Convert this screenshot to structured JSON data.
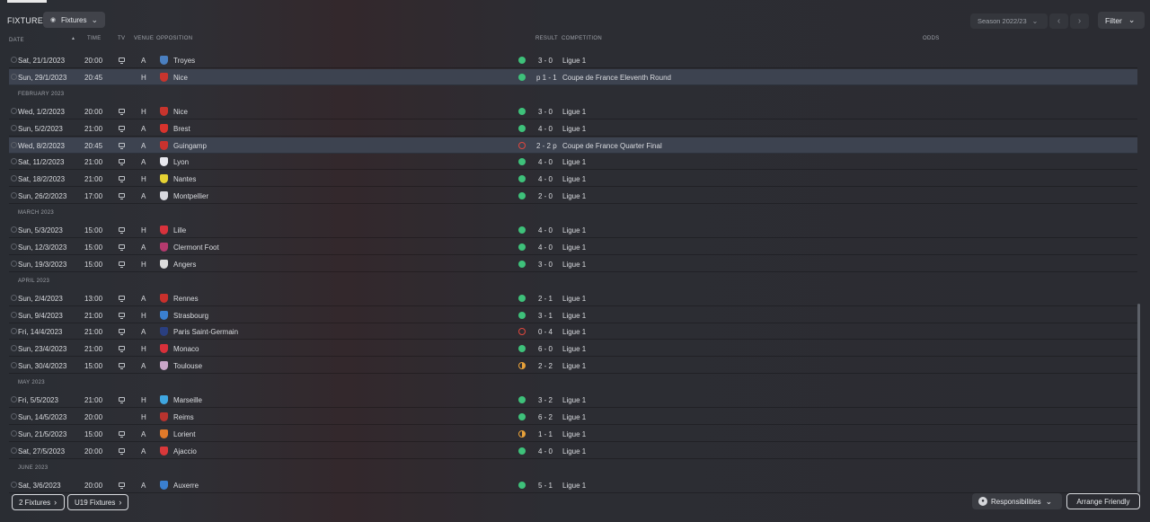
{
  "header": {
    "title": "FIXTURES",
    "view_dropdown": "Fixtures",
    "season": "Season 2022/23",
    "filter": "Filter"
  },
  "columns": {
    "date": "DATE",
    "time": "TIME",
    "tv": "TV",
    "venue": "VENUE",
    "opposition": "OPPOSITION",
    "result": "RESULT",
    "competition": "COMPETITION",
    "odds": "ODDS"
  },
  "rows": [
    {
      "kind": "match",
      "date": "Sat, 21/1/2023",
      "time": "20:00",
      "tv": true,
      "venue": "A",
      "opp": "Troyes",
      "crest": "#4a7fc0",
      "outcome": "win",
      "score": "3 - 0",
      "comp": "Ligue 1"
    },
    {
      "kind": "match",
      "date": "Sun, 29/1/2023",
      "time": "20:45",
      "tv": false,
      "venue": "H",
      "opp": "Nice",
      "crest": "#c7342d",
      "outcome": "win",
      "score": "p 1 - 1",
      "comp": "Coupe de France Eleventh Round",
      "selected": true
    },
    {
      "kind": "month",
      "label": "FEBRUARY 2023"
    },
    {
      "kind": "match",
      "date": "Wed, 1/2/2023",
      "time": "20:00",
      "tv": true,
      "venue": "H",
      "opp": "Nice",
      "crest": "#c7342d",
      "outcome": "win",
      "score": "3 - 0",
      "comp": "Ligue 1"
    },
    {
      "kind": "match",
      "date": "Sun, 5/2/2023",
      "time": "21:00",
      "tv": true,
      "venue": "A",
      "opp": "Brest",
      "crest": "#d8332d",
      "outcome": "win",
      "score": "4 - 0",
      "comp": "Ligue 1"
    },
    {
      "kind": "match",
      "date": "Wed, 8/2/2023",
      "time": "20:45",
      "tv": true,
      "venue": "A",
      "opp": "Guingamp",
      "crest": "#c9322e",
      "outcome": "loss",
      "score": "2 - 2 p",
      "comp": "Coupe de France Quarter Final",
      "selected": true
    },
    {
      "kind": "match",
      "date": "Sat, 11/2/2023",
      "time": "21:00",
      "tv": true,
      "venue": "A",
      "opp": "Lyon",
      "crest": "#e8e8ee",
      "outcome": "win",
      "score": "4 - 0",
      "comp": "Ligue 1"
    },
    {
      "kind": "match",
      "date": "Sat, 18/2/2023",
      "time": "21:00",
      "tv": true,
      "venue": "H",
      "opp": "Nantes",
      "crest": "#e6d233",
      "outcome": "win",
      "score": "4 - 0",
      "comp": "Ligue 1"
    },
    {
      "kind": "match",
      "date": "Sun, 26/2/2023",
      "time": "17:00",
      "tv": true,
      "venue": "A",
      "opp": "Montpellier",
      "crest": "#d8d8de",
      "outcome": "win",
      "score": "2 - 0",
      "comp": "Ligue 1"
    },
    {
      "kind": "month",
      "label": "MARCH 2023"
    },
    {
      "kind": "match",
      "date": "Sun, 5/3/2023",
      "time": "15:00",
      "tv": true,
      "venue": "H",
      "opp": "Lille",
      "crest": "#d8323c",
      "outcome": "win",
      "score": "4 - 0",
      "comp": "Ligue 1"
    },
    {
      "kind": "match",
      "date": "Sun, 12/3/2023",
      "time": "15:00",
      "tv": true,
      "venue": "A",
      "opp": "Clermont Foot",
      "crest": "#b53a6e",
      "outcome": "win",
      "score": "4 - 0",
      "comp": "Ligue 1"
    },
    {
      "kind": "match",
      "date": "Sun, 19/3/2023",
      "time": "15:00",
      "tv": true,
      "venue": "H",
      "opp": "Angers",
      "crest": "#dcdcdc",
      "outcome": "win",
      "score": "3 - 0",
      "comp": "Ligue 1"
    },
    {
      "kind": "month",
      "label": "APRIL 2023"
    },
    {
      "kind": "match",
      "date": "Sun, 2/4/2023",
      "time": "13:00",
      "tv": true,
      "venue": "A",
      "opp": "Rennes",
      "crest": "#c8302c",
      "outcome": "win",
      "score": "2 - 1",
      "comp": "Ligue 1"
    },
    {
      "kind": "match",
      "date": "Sun, 9/4/2023",
      "time": "21:00",
      "tv": true,
      "venue": "H",
      "opp": "Strasbourg",
      "crest": "#3a7fcf",
      "outcome": "win",
      "score": "3 - 1",
      "comp": "Ligue 1"
    },
    {
      "kind": "match",
      "date": "Fri, 14/4/2023",
      "time": "21:00",
      "tv": true,
      "venue": "A",
      "opp": "Paris Saint-Germain",
      "crest": "#2a3f80",
      "outcome": "loss",
      "score": "0 - 4",
      "comp": "Ligue 1"
    },
    {
      "kind": "match",
      "date": "Sun, 23/4/2023",
      "time": "21:00",
      "tv": true,
      "venue": "H",
      "opp": "Monaco",
      "crest": "#d8303a",
      "outcome": "win",
      "score": "6 - 0",
      "comp": "Ligue 1"
    },
    {
      "kind": "match",
      "date": "Sun, 30/4/2023",
      "time": "15:00",
      "tv": true,
      "venue": "A",
      "opp": "Toulouse",
      "crest": "#c9a6c8",
      "outcome": "draw",
      "score": "2 - 2",
      "comp": "Ligue 1"
    },
    {
      "kind": "month",
      "label": "MAY 2023"
    },
    {
      "kind": "match",
      "date": "Fri, 5/5/2023",
      "time": "21:00",
      "tv": true,
      "venue": "H",
      "opp": "Marseille",
      "crest": "#3fa6e0",
      "outcome": "win",
      "score": "3 - 2",
      "comp": "Ligue 1"
    },
    {
      "kind": "match",
      "date": "Sun, 14/5/2023",
      "time": "20:00",
      "tv": false,
      "venue": "H",
      "opp": "Reims",
      "crest": "#b8332e",
      "outcome": "win",
      "score": "6 - 2",
      "comp": "Ligue 1"
    },
    {
      "kind": "match",
      "date": "Sun, 21/5/2023",
      "time": "15:00",
      "tv": true,
      "venue": "A",
      "opp": "Lorient",
      "crest": "#e07a2a",
      "outcome": "draw",
      "score": "1 - 1",
      "comp": "Ligue 1"
    },
    {
      "kind": "match",
      "date": "Sat, 27/5/2023",
      "time": "20:00",
      "tv": true,
      "venue": "A",
      "opp": "Ajaccio",
      "crest": "#d8383a",
      "outcome": "win",
      "score": "4 - 0",
      "comp": "Ligue 1"
    },
    {
      "kind": "month",
      "label": "JUNE 2023"
    },
    {
      "kind": "match",
      "date": "Sat, 3/6/2023",
      "time": "20:00",
      "tv": true,
      "venue": "A",
      "opp": "Auxerre",
      "crest": "#3a7fcf",
      "outcome": "win",
      "score": "5 - 1",
      "comp": "Ligue 1"
    }
  ],
  "footer": {
    "fixtures2": "2 Fixtures",
    "u19": "U19 Fixtures",
    "responsibilities": "Responsibilities",
    "arrange": "Arrange Friendly"
  },
  "colors": {
    "win": "#3ec17a",
    "loss": "#e0473e",
    "draw": "#e8a13a",
    "selected_row": "#3d4350"
  }
}
